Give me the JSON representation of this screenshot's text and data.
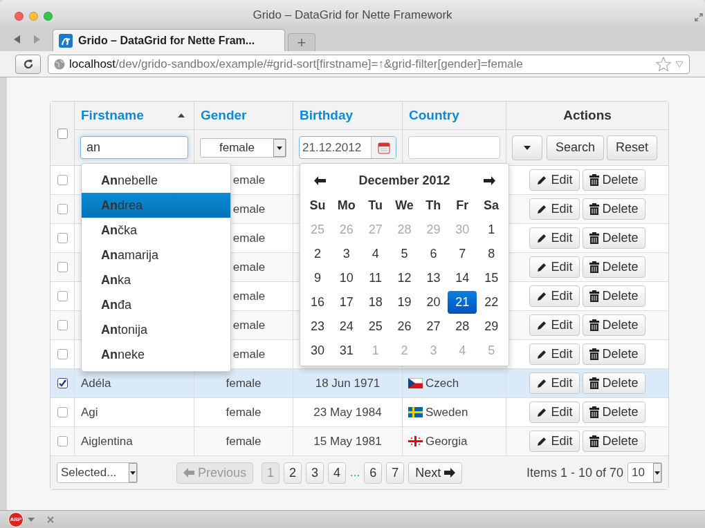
{
  "window": {
    "title": "Grido – DataGrid for Nette Framework"
  },
  "browser": {
    "tabs": [
      {
        "label": "Grido – DataGrid for Nette Fram...",
        "selected": true
      }
    ],
    "new_tab": "+",
    "address": {
      "host": "localhost",
      "path": "/dev/grido-sandbox/example/#grid-sort[firstname]=↑&grid-filter[gender]=female"
    }
  },
  "grid": {
    "select_all": {
      "checked": false
    },
    "columns": [
      {
        "label": "Firstname",
        "kind": "link",
        "sorted": true
      },
      {
        "label": "Gender",
        "kind": "link"
      },
      {
        "label": "Birthday",
        "kind": "link"
      },
      {
        "label": "Country",
        "kind": "link"
      },
      {
        "label": "Actions",
        "kind": "plain"
      }
    ],
    "filters": {
      "firstname": "an",
      "gender": "female",
      "birthday": "21.12.2012",
      "search": "Search",
      "reset": "Reset"
    },
    "rows": [
      {
        "checked": false,
        "gender": "emale",
        "edit": "Edit",
        "delete": "Delete"
      },
      {
        "checked": false,
        "gender": "emale",
        "edit": "Edit",
        "delete": "Delete"
      },
      {
        "checked": false,
        "gender": "emale",
        "edit": "Edit",
        "delete": "Delete"
      },
      {
        "checked": false,
        "gender": "emale",
        "edit": "Edit",
        "delete": "Delete"
      },
      {
        "checked": false,
        "gender": "emale",
        "edit": "Edit",
        "delete": "Delete"
      },
      {
        "checked": false,
        "gender": "emale",
        "edit": "Edit",
        "delete": "Delete"
      },
      {
        "checked": false,
        "gender": "emale",
        "edit": "Edit",
        "delete": "Delete"
      },
      {
        "checked": true,
        "firstname": "Adéla",
        "gender": "female",
        "birthday": "18 Jun 1971",
        "country": {
          "name": "Czech",
          "kind": "czech"
        },
        "edit": "Edit",
        "delete": "Delete"
      },
      {
        "checked": false,
        "firstname": "Agi",
        "gender": "female",
        "birthday": "23 May 1984",
        "country": {
          "name": "Sweden",
          "kind": "swedish"
        },
        "edit": "Edit",
        "delete": "Delete"
      },
      {
        "checked": false,
        "firstname": "Aiglentina",
        "gender": "female",
        "birthday": "15 May 1981",
        "country": {
          "name": "Georgia",
          "kind": "georgian"
        },
        "edit": "Edit",
        "delete": "Delete"
      }
    ],
    "autocomplete": [
      {
        "label": "**An**nebelle",
        "selected": false
      },
      {
        "label": "**An**drea",
        "selected": true
      },
      {
        "label": "**An**čka",
        "selected": false
      },
      {
        "label": "**An**amarija",
        "selected": false
      },
      {
        "label": "**An**ka",
        "selected": false
      },
      {
        "label": "**An**đa",
        "selected": false
      },
      {
        "label": "**An**tonija",
        "selected": false
      },
      {
        "label": "**An**neke",
        "selected": false
      }
    ],
    "calendar": {
      "title": "December 2012",
      "weekdays": [
        "Su",
        "Mo",
        "Tu",
        "We",
        "Th",
        "Fr",
        "Sa"
      ],
      "weeks": [
        [
          {
            "day": "25",
            "muted": true
          },
          {
            "day": "26",
            "muted": true
          },
          {
            "day": "27",
            "muted": true
          },
          {
            "day": "28",
            "muted": true
          },
          {
            "day": "29",
            "muted": true
          },
          {
            "day": "30",
            "muted": true
          },
          {
            "day": "1",
            "muted": false
          }
        ],
        [
          {
            "day": "2",
            "muted": false
          },
          {
            "day": "3",
            "muted": false
          },
          {
            "day": "4",
            "muted": false
          },
          {
            "day": "5",
            "muted": false
          },
          {
            "day": "6",
            "muted": false
          },
          {
            "day": "7",
            "muted": false
          },
          {
            "day": "8",
            "muted": false
          }
        ],
        [
          {
            "day": "9",
            "muted": false
          },
          {
            "day": "10",
            "muted": false
          },
          {
            "day": "11",
            "muted": false
          },
          {
            "day": "12",
            "muted": false
          },
          {
            "day": "13",
            "muted": false
          },
          {
            "day": "14",
            "muted": false
          },
          {
            "day": "15",
            "muted": false
          }
        ],
        [
          {
            "day": "16",
            "muted": false
          },
          {
            "day": "17",
            "muted": false
          },
          {
            "day": "18",
            "muted": false
          },
          {
            "day": "19",
            "muted": false
          },
          {
            "day": "20",
            "muted": false
          },
          {
            "day": "21",
            "muted": false,
            "selected": true
          },
          {
            "day": "22",
            "muted": false
          }
        ],
        [
          {
            "day": "23",
            "muted": false
          },
          {
            "day": "24",
            "muted": false
          },
          {
            "day": "25",
            "muted": false
          },
          {
            "day": "26",
            "muted": false
          },
          {
            "day": "27",
            "muted": false
          },
          {
            "day": "28",
            "muted": false
          },
          {
            "day": "29",
            "muted": false
          }
        ],
        [
          {
            "day": "30",
            "muted": false
          },
          {
            "day": "31",
            "muted": false
          },
          {
            "day": "1",
            "muted": true
          },
          {
            "day": "2",
            "muted": true
          },
          {
            "day": "3",
            "muted": true
          },
          {
            "day": "4",
            "muted": true
          },
          {
            "day": "5",
            "muted": true
          }
        ]
      ]
    },
    "footer": {
      "operation": "Selected...",
      "previous": {
        "label": "Previous",
        "disabled": true
      },
      "pages": [
        {
          "label": "1",
          "selected": true
        },
        {
          "label": "2",
          "selected": false
        },
        {
          "label": "3",
          "selected": false
        },
        {
          "label": "4",
          "selected": false
        },
        {
          "label": "...",
          "kind": "ellipsis"
        },
        {
          "label": "6",
          "selected": false
        },
        {
          "label": "7",
          "selected": false
        }
      ],
      "next": {
        "label": "Next",
        "disabled": false
      },
      "items": "Items 1 - 10 of 70",
      "per_page": "10"
    }
  },
  "status_bar": {
    "adblock": "ABP"
  }
}
